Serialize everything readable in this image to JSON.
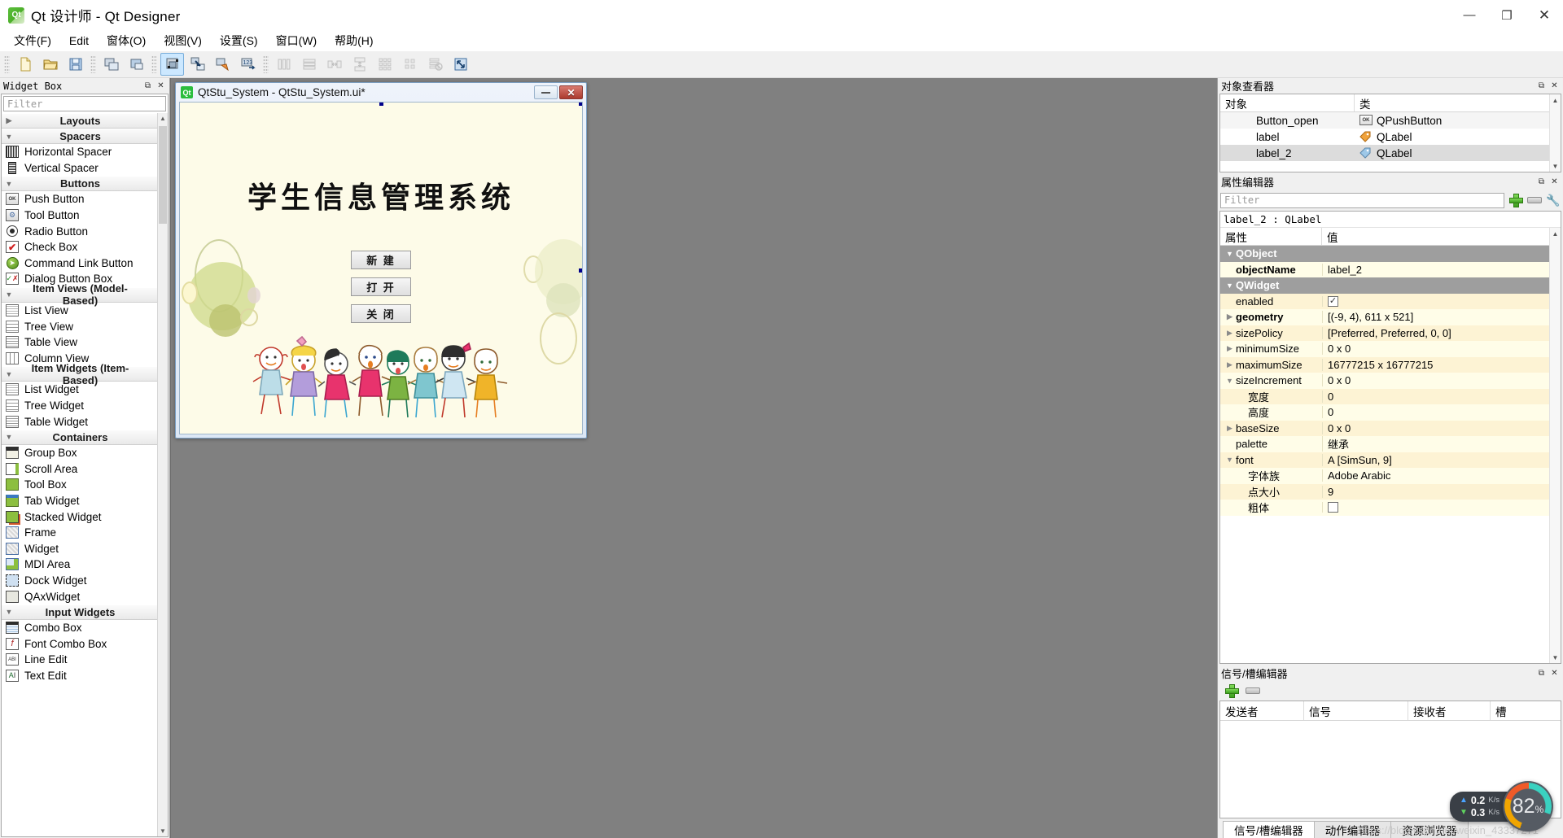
{
  "window": {
    "title": "Qt 设计师 - Qt Designer",
    "app_icon": "qt-icon",
    "minimize": "—",
    "maximize": "❐",
    "close": "✕"
  },
  "menubar": [
    {
      "label": "文件(F)",
      "name": "menu-file"
    },
    {
      "label": "Edit",
      "name": "menu-edit"
    },
    {
      "label": "窗体(O)",
      "name": "menu-form"
    },
    {
      "label": "视图(V)",
      "name": "menu-view"
    },
    {
      "label": "设置(S)",
      "name": "menu-settings"
    },
    {
      "label": "窗口(W)",
      "name": "menu-window"
    },
    {
      "label": "帮助(H)",
      "name": "menu-help"
    }
  ],
  "toolbar": {
    "groups": [
      {
        "buttons": [
          {
            "name": "new-form-icon",
            "glyph": "new"
          },
          {
            "name": "open-form-icon",
            "glyph": "open"
          },
          {
            "name": "save-form-icon",
            "glyph": "save"
          }
        ]
      },
      {
        "buttons": [
          {
            "name": "undo-icon",
            "glyph": "copywin"
          },
          {
            "name": "redo-icon",
            "glyph": "win"
          }
        ]
      },
      {
        "buttons": [
          {
            "name": "edit-widgets-icon",
            "glyph": "editwidget",
            "active": true
          },
          {
            "name": "edit-signals-slots-icon",
            "glyph": "signals"
          },
          {
            "name": "edit-buddies-icon",
            "glyph": "buddy"
          },
          {
            "name": "edit-tab-order-icon",
            "glyph": "taborder"
          }
        ]
      },
      {
        "buttons": [
          {
            "name": "layout-horizontally-icon",
            "glyph": "lay-h",
            "disabled": true
          },
          {
            "name": "layout-vertically-icon",
            "glyph": "lay-v",
            "disabled": true
          },
          {
            "name": "layout-splitter-h-icon",
            "glyph": "split-h",
            "disabled": true
          },
          {
            "name": "layout-splitter-v-icon",
            "glyph": "split-v",
            "disabled": true
          },
          {
            "name": "layout-grid-icon",
            "glyph": "grid",
            "disabled": true
          },
          {
            "name": "layout-form-icon",
            "glyph": "formlay",
            "disabled": true
          },
          {
            "name": "break-layout-icon",
            "glyph": "break",
            "disabled": true
          },
          {
            "name": "adjust-size-icon",
            "glyph": "adjust"
          }
        ]
      }
    ]
  },
  "widget_box": {
    "title": "Widget Box",
    "filter_placeholder": "Filter",
    "sections": [
      {
        "label": "Layouts",
        "collapsed": true,
        "items": []
      },
      {
        "label": "Spacers",
        "collapsed": false,
        "items": [
          {
            "label": "Horizontal Spacer",
            "icon": "horizontal-spacer-icon"
          },
          {
            "label": "Vertical Spacer",
            "icon": "vertical-spacer-icon"
          }
        ]
      },
      {
        "label": "Buttons",
        "collapsed": false,
        "items": [
          {
            "label": "Push Button",
            "icon": "push-button-icon"
          },
          {
            "label": "Tool Button",
            "icon": "tool-button-icon"
          },
          {
            "label": "Radio Button",
            "icon": "radio-button-icon"
          },
          {
            "label": "Check Box",
            "icon": "check-box-icon"
          },
          {
            "label": "Command Link Button",
            "icon": "command-link-button-icon"
          },
          {
            "label": "Dialog Button Box",
            "icon": "dialog-button-box-icon"
          }
        ]
      },
      {
        "label": "Item Views (Model-Based)",
        "collapsed": false,
        "items": [
          {
            "label": "List View",
            "icon": "list-view-icon"
          },
          {
            "label": "Tree View",
            "icon": "tree-view-icon"
          },
          {
            "label": "Table View",
            "icon": "table-view-icon"
          },
          {
            "label": "Column View",
            "icon": "column-view-icon"
          }
        ]
      },
      {
        "label": "Item Widgets (Item-Based)",
        "collapsed": false,
        "items": [
          {
            "label": "List Widget",
            "icon": "list-widget-icon"
          },
          {
            "label": "Tree Widget",
            "icon": "tree-widget-icon"
          },
          {
            "label": "Table Widget",
            "icon": "table-widget-icon"
          }
        ]
      },
      {
        "label": "Containers",
        "collapsed": false,
        "items": [
          {
            "label": "Group Box",
            "icon": "group-box-icon"
          },
          {
            "label": "Scroll Area",
            "icon": "scroll-area-icon"
          },
          {
            "label": "Tool Box",
            "icon": "tool-box-icon"
          },
          {
            "label": "Tab Widget",
            "icon": "tab-widget-icon"
          },
          {
            "label": "Stacked Widget",
            "icon": "stacked-widget-icon"
          },
          {
            "label": "Frame",
            "icon": "frame-icon"
          },
          {
            "label": "Widget",
            "icon": "widget-icon"
          },
          {
            "label": "MDI Area",
            "icon": "mdi-area-icon"
          },
          {
            "label": "Dock Widget",
            "icon": "dock-widget-icon"
          },
          {
            "label": "QAxWidget",
            "icon": "qaxwidget-icon"
          }
        ]
      },
      {
        "label": "Input Widgets",
        "collapsed": false,
        "items": [
          {
            "label": "Combo Box",
            "icon": "combo-box-icon"
          },
          {
            "label": "Font Combo Box",
            "icon": "font-combo-box-icon"
          },
          {
            "label": "Line Edit",
            "icon": "line-edit-icon"
          },
          {
            "label": "Text Edit",
            "icon": "text-edit-icon"
          }
        ]
      }
    ]
  },
  "form_window": {
    "icon_text": "Qt",
    "title": "QtStu_System - QtStu_System.ui*",
    "minimize": "",
    "close": "✕",
    "heading": "学生信息管理系统",
    "buttons": [
      {
        "label": "新 建",
        "name": "form-button-new"
      },
      {
        "label": "打 开",
        "name": "form-button-open"
      },
      {
        "label": "关 闭",
        "name": "form-button-close"
      }
    ]
  },
  "object_inspector": {
    "title": "对象查看器",
    "columns": [
      "对象",
      "类"
    ],
    "rows": [
      {
        "object": "Button_open",
        "class": "QPushButton",
        "icon": "push-button-icon",
        "selected": false
      },
      {
        "object": "label",
        "class": "QLabel",
        "icon": "label-icon-orange",
        "selected": false
      },
      {
        "object": "label_2",
        "class": "QLabel",
        "icon": "label-icon-blue",
        "selected": true
      }
    ]
  },
  "property_editor": {
    "title": "属性编辑器",
    "filter_placeholder": "Filter",
    "object_line": "label_2 : QLabel",
    "columns": [
      "属性",
      "值"
    ],
    "rows": [
      {
        "kind": "group",
        "name": "QObject",
        "value": "",
        "expander": "v"
      },
      {
        "kind": "prop",
        "name": "objectName",
        "value": "label_2",
        "bold": true,
        "indent": 1
      },
      {
        "kind": "group",
        "name": "QWidget",
        "value": "",
        "expander": "v"
      },
      {
        "kind": "prop",
        "name": "enabled",
        "value": "",
        "checkbox": true,
        "checked": true,
        "indent": 1
      },
      {
        "kind": "prop",
        "name": "geometry",
        "value": "[(-9, 4), 611 x 521]",
        "bold": true,
        "expander": ">"
      },
      {
        "kind": "prop",
        "name": "sizePolicy",
        "value": "[Preferred, Preferred, 0, 0]",
        "expander": ">"
      },
      {
        "kind": "prop",
        "name": "minimumSize",
        "value": "0 x 0",
        "expander": ">"
      },
      {
        "kind": "prop",
        "name": "maximumSize",
        "value": "16777215 x 16777215",
        "expander": ">"
      },
      {
        "kind": "prop",
        "name": "sizeIncrement",
        "value": "0 x 0",
        "expander": "v"
      },
      {
        "kind": "prop",
        "name": "宽度",
        "value": "0",
        "indent": 2
      },
      {
        "kind": "prop",
        "name": "高度",
        "value": "0",
        "indent": 2
      },
      {
        "kind": "prop",
        "name": "baseSize",
        "value": "0 x 0",
        "expander": ">"
      },
      {
        "kind": "prop",
        "name": "palette",
        "value": "继承",
        "indent": 1
      },
      {
        "kind": "prop",
        "name": "font",
        "value": "A  [SimSun, 9]",
        "expander": "v"
      },
      {
        "kind": "prop",
        "name": "字体族",
        "value": "Adobe Arabic",
        "indent": 2
      },
      {
        "kind": "prop",
        "name": "点大小",
        "value": "9",
        "indent": 2
      },
      {
        "kind": "prop",
        "name": "粗体",
        "value": "",
        "checkbox": true,
        "checked": false,
        "indent": 2
      }
    ]
  },
  "signal_slot_editor": {
    "title": "信号/槽编辑器",
    "columns": [
      "发送者",
      "信号",
      "接收者",
      "槽"
    ],
    "rows": []
  },
  "bottom_tabs": [
    {
      "label": "信号/槽编辑器",
      "active": true
    },
    {
      "label": "动作编辑器",
      "active": false
    },
    {
      "label": "资源浏览器",
      "active": false
    }
  ],
  "net_widget": {
    "upload": "0.2",
    "upload_unit": "K/s",
    "download": "0.3",
    "download_unit": "K/s",
    "percent": "82",
    "percent_unit": "%"
  },
  "watermark": "https://blog.csdn.net/weixin_43337271",
  "colors": {
    "accent_blue": "#cce8ff",
    "form_bg": "#fdfbe8",
    "canvas_bg": "#808080",
    "prop_yellow": "#fffde8",
    "prop_yellow_alt": "#fdf3d4",
    "group_gray": "#9e9e9e",
    "close_red": "#ab3b2e"
  }
}
